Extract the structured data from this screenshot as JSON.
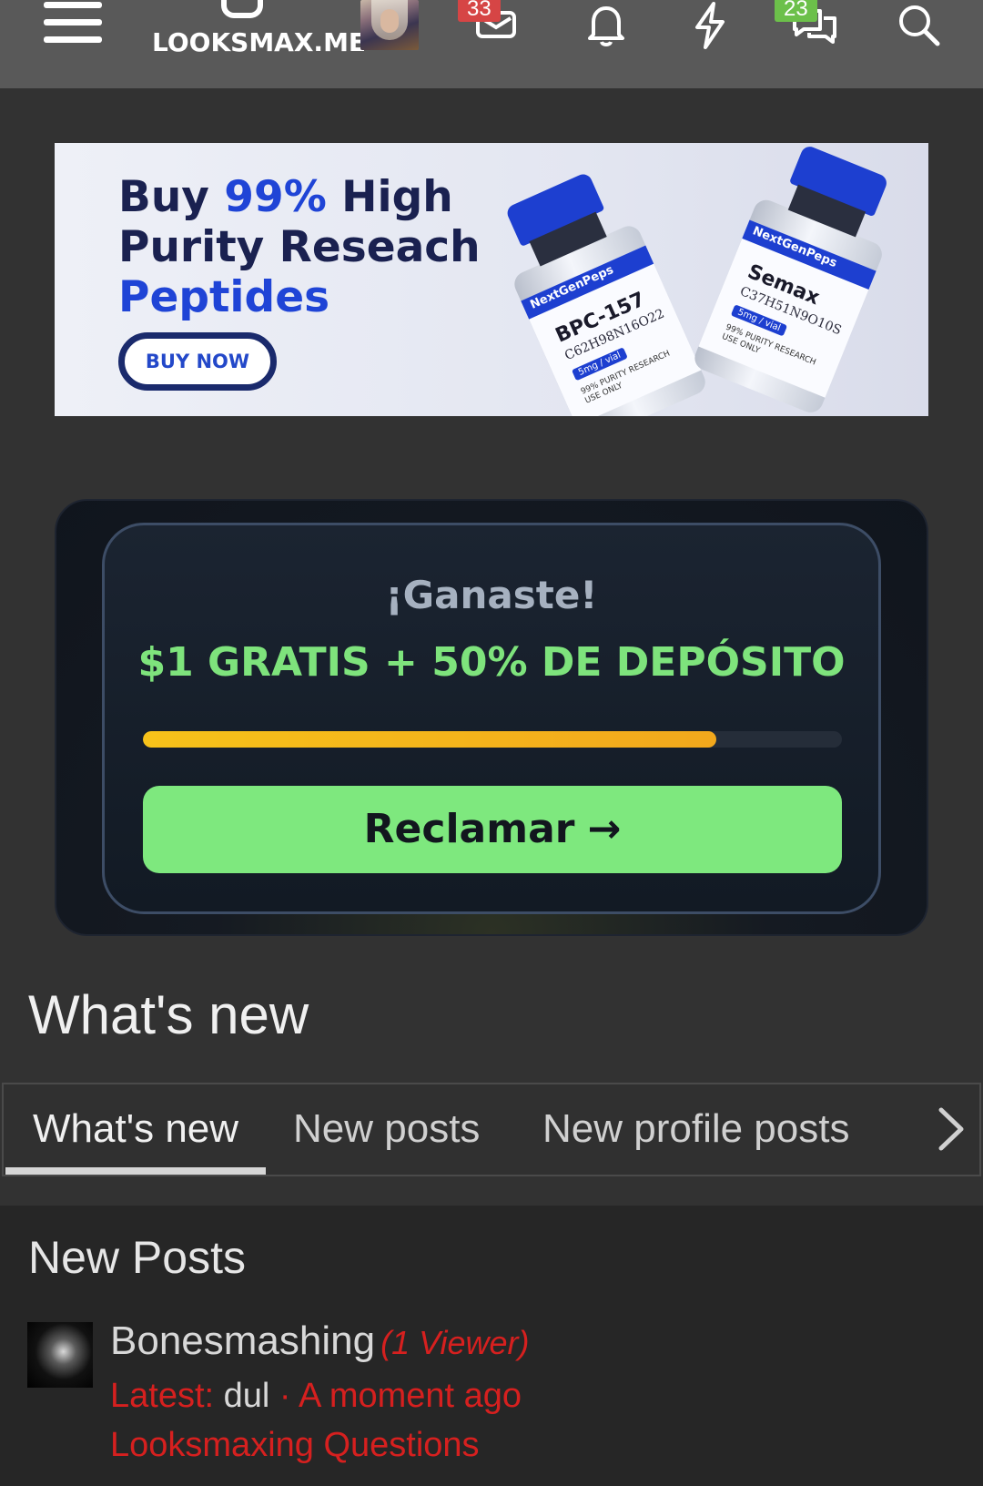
{
  "header": {
    "logo_text": "LOOKSMAX.ME",
    "inbox_badge": "33",
    "conversations_badge": "23",
    "colors": {
      "bar": "#595959",
      "inbox_badge": "#d64545",
      "conversations_badge": "#6cc04a"
    },
    "icons": [
      "menu-icon",
      "inbox-icon",
      "bell-icon",
      "bolt-icon",
      "chat-icon",
      "search-icon"
    ]
  },
  "ad": {
    "line1_a": "Buy ",
    "line1_b": "99%",
    "line1_c": " High",
    "line2": "Purity Reseach",
    "line3": "Peptides",
    "button": "BUY NOW",
    "vials": [
      {
        "brand": "NextGenPeps",
        "name": "BPC-157",
        "formula": "C62H98N16O22",
        "dose": "5mg / vial",
        "purity": "99% PURITY RESEARCH USE ONLY"
      },
      {
        "brand": "NextGenPeps",
        "name": "Semax",
        "formula": "C37H51N9O10S",
        "dose": "5mg / vial",
        "purity": "99% PURITY RESEARCH USE ONLY"
      }
    ]
  },
  "promo": {
    "title": "¡Ganaste!",
    "offer": "$1 GRATIS + 50% DE DEPÓSITO",
    "progress": 0.82,
    "button": "Reclamar",
    "colors": {
      "offer": "#7ee37c",
      "progress": "#f7c21a",
      "button": "#7ee87e"
    }
  },
  "whats_new": {
    "heading": "What's new",
    "tabs": [
      "What's new",
      "New posts",
      "New profile posts"
    ],
    "active_tab": 0
  },
  "new_posts": {
    "heading": "New Posts",
    "items": [
      {
        "title": "Bonesmashing",
        "viewers": "(1 Viewer)",
        "latest_label": "Latest:",
        "latest_user": "dul",
        "time": "· A moment ago",
        "forum": "Looksmaxing Questions"
      }
    ]
  }
}
